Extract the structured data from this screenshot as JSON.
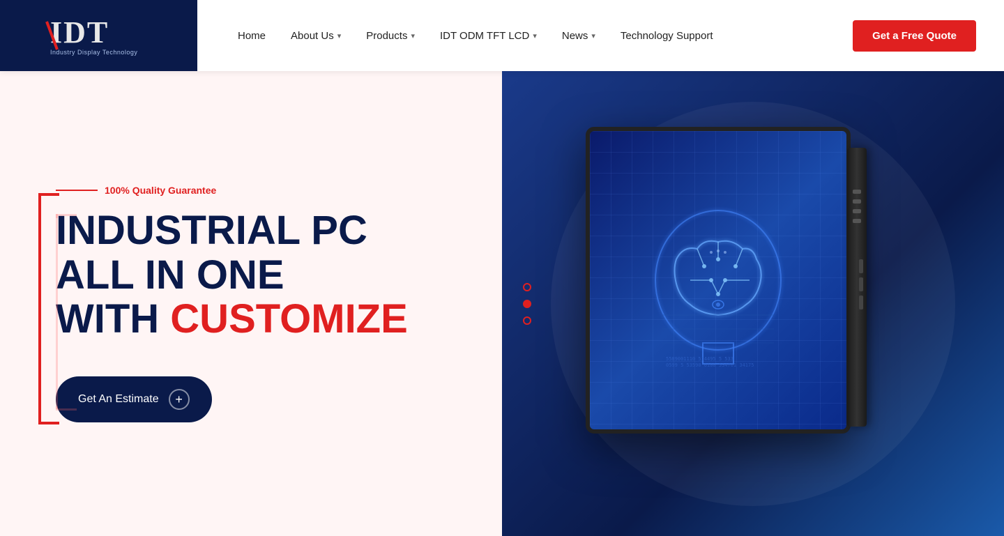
{
  "navbar": {
    "logo_alt": "IDT Industry Display Technology",
    "links": [
      {
        "label": "Home",
        "has_dropdown": false
      },
      {
        "label": "About Us",
        "has_dropdown": true
      },
      {
        "label": "Products",
        "has_dropdown": true
      },
      {
        "label": "IDT ODM TFT LCD",
        "has_dropdown": true
      },
      {
        "label": "News",
        "has_dropdown": true
      },
      {
        "label": "Technology Support",
        "has_dropdown": false
      }
    ],
    "cta_label": "Get a Free Quote"
  },
  "hero": {
    "quality_label": "100% Quality Guarantee",
    "title_line1": "INDUSTRIAL PC",
    "title_line2": "ALL IN ONE",
    "title_line3_prefix": "WITH ",
    "title_line3_highlight": "CUSTOMIZE",
    "cta_label": "Get An Estimate",
    "slides": [
      {
        "active": false
      },
      {
        "active": true
      },
      {
        "active": false
      }
    ]
  }
}
